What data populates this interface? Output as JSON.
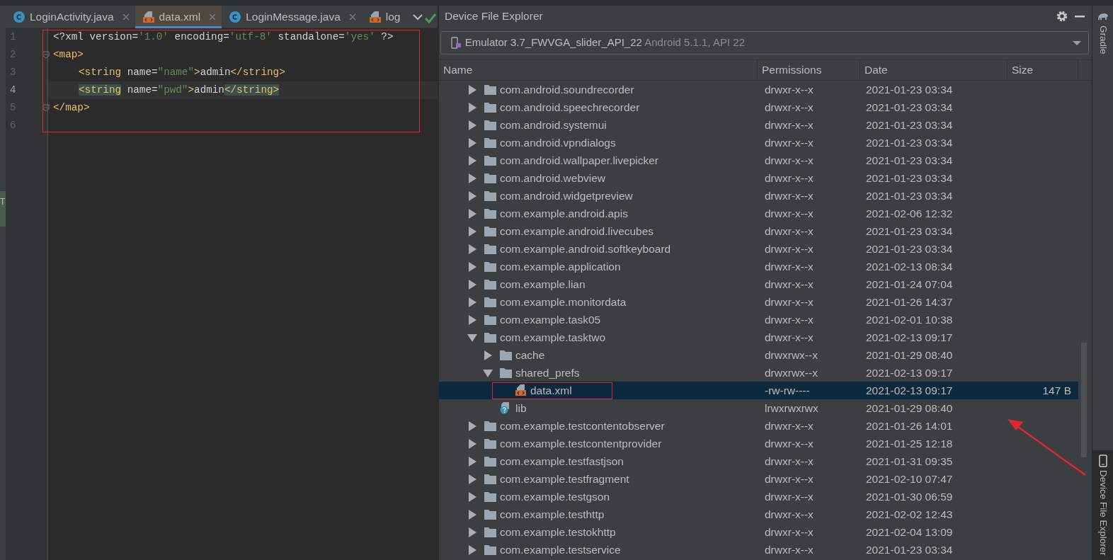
{
  "edge_tab": {
    "label": "T"
  },
  "editor": {
    "tabs": [
      {
        "label": "LoginActivity.java",
        "kind": "class",
        "selected": false
      },
      {
        "label": "data.xml",
        "kind": "xml",
        "selected": true
      },
      {
        "label": "LoginMessage.java",
        "kind": "class",
        "selected": false
      },
      {
        "label": "log",
        "kind": "xml",
        "selected": false
      }
    ],
    "lines": [
      {
        "number": "1",
        "current": false,
        "fold": false,
        "indented": false,
        "tokens": [
          {
            "kind": "plain",
            "text": "<?xml version="
          },
          {
            "kind": "value",
            "text": "'1.0'"
          },
          {
            "kind": "plain",
            "text": " encoding="
          },
          {
            "kind": "value",
            "text": "'utf-8'"
          },
          {
            "kind": "plain",
            "text": " standalone="
          },
          {
            "kind": "value",
            "text": "'yes'"
          },
          {
            "kind": "plain",
            "text": " ?>"
          }
        ]
      },
      {
        "number": "2",
        "current": false,
        "fold": true,
        "indented": false,
        "tokens": [
          {
            "kind": "tag",
            "text": "<map>"
          }
        ]
      },
      {
        "number": "3",
        "current": false,
        "fold": false,
        "indented": true,
        "tokens": [
          {
            "kind": "tag",
            "text": "<string"
          },
          {
            "kind": "plain",
            "text": " name="
          },
          {
            "kind": "value",
            "text": "\"name\""
          },
          {
            "kind": "tag",
            "text": ">"
          },
          {
            "kind": "plain",
            "text": "admin"
          },
          {
            "kind": "tag",
            "text": "</string>"
          }
        ]
      },
      {
        "number": "4",
        "current": true,
        "fold": false,
        "indented": true,
        "tokens": [
          {
            "kind": "match",
            "text": "<string"
          },
          {
            "kind": "plain",
            "text": " name="
          },
          {
            "kind": "value",
            "text": "\"pwd\""
          },
          {
            "kind": "tag",
            "text": ">"
          },
          {
            "kind": "plain",
            "text": "admin"
          },
          {
            "kind": "match",
            "text": "</string>"
          }
        ]
      },
      {
        "number": "5",
        "current": false,
        "fold": true,
        "indented": false,
        "tokens": [
          {
            "kind": "tag",
            "text": "</map>"
          }
        ]
      },
      {
        "number": "6",
        "current": false,
        "fold": false
      }
    ]
  },
  "explorer": {
    "title": "Device File Explorer",
    "device": {
      "name": "Emulator 3.7_FWVGA_slider_API_22",
      "details": "Android 5.1.1, API 22"
    },
    "columns": [
      "Name",
      "Permissions",
      "Date",
      "Size"
    ],
    "rows": [
      {
        "name": "com.android.soundrecorder",
        "kind": "folder",
        "expanded": false,
        "selected": false,
        "permissions": "drwxr-x--x",
        "date": "2021-01-23 03:34"
      },
      {
        "name": "com.android.speechrecorder",
        "kind": "folder",
        "expanded": false,
        "selected": false,
        "permissions": "drwxr-x--x",
        "date": "2021-01-23 03:34"
      },
      {
        "name": "com.android.systemui",
        "kind": "folder",
        "expanded": false,
        "selected": false,
        "permissions": "drwxr-x--x",
        "date": "2021-01-23 03:34"
      },
      {
        "name": "com.android.vpndialogs",
        "kind": "folder",
        "expanded": false,
        "selected": false,
        "permissions": "drwxr-x--x",
        "date": "2021-01-23 03:34"
      },
      {
        "name": "com.android.wallpaper.livepicker",
        "kind": "folder",
        "expanded": false,
        "selected": false,
        "permissions": "drwxr-x--x",
        "date": "2021-01-23 03:34"
      },
      {
        "name": "com.android.webview",
        "kind": "folder",
        "expanded": false,
        "selected": false,
        "permissions": "drwxr-x--x",
        "date": "2021-01-23 03:34"
      },
      {
        "name": "com.android.widgetpreview",
        "kind": "folder",
        "expanded": false,
        "selected": false,
        "permissions": "drwxr-x--x",
        "date": "2021-01-23 03:34"
      },
      {
        "name": "com.example.android.apis",
        "kind": "folder",
        "expanded": false,
        "selected": false,
        "permissions": "drwxr-x--x",
        "date": "2021-02-06 12:32"
      },
      {
        "name": "com.example.android.livecubes",
        "kind": "folder",
        "expanded": false,
        "selected": false,
        "permissions": "drwxr-x--x",
        "date": "2021-01-23 03:34"
      },
      {
        "name": "com.example.android.softkeyboard",
        "kind": "folder",
        "expanded": false,
        "selected": false,
        "permissions": "drwxr-x--x",
        "date": "2021-01-23 03:34"
      },
      {
        "name": "com.example.application",
        "kind": "folder",
        "expanded": false,
        "selected": false,
        "permissions": "drwxr-x--x",
        "date": "2021-02-13 08:34"
      },
      {
        "name": "com.example.lian",
        "kind": "folder",
        "expanded": false,
        "selected": false,
        "permissions": "drwxr-x--x",
        "date": "2021-01-24 07:04"
      },
      {
        "name": "com.example.monitordata",
        "kind": "folder",
        "expanded": false,
        "selected": false,
        "permissions": "drwxr-x--x",
        "date": "2021-01-26 14:37"
      },
      {
        "name": "com.example.task05",
        "kind": "folder",
        "expanded": false,
        "selected": false,
        "permissions": "drwxr-x--x",
        "date": "2021-02-01 10:38"
      },
      {
        "name": "com.example.tasktwo",
        "kind": "folder",
        "expanded": true,
        "selected": false,
        "permissions": "drwxr-x--x",
        "date": "2021-02-13 09:17",
        "children": [
          {
            "name": "cache",
            "kind": "folder",
            "expanded": false,
            "selected": false,
            "permissions": "drwxrwx--x",
            "date": "2021-01-29 08:40"
          },
          {
            "name": "shared_prefs",
            "kind": "folder",
            "expanded": true,
            "selected": false,
            "permissions": "drwxrwx--x",
            "date": "2021-02-13 09:17",
            "children": [
              {
                "name": "data.xml",
                "kind": "xml",
                "selected": true,
                "framed": true,
                "permissions": "-rw-rw----",
                "date": "2021-02-13 09:17",
                "size": "147 B"
              }
            ]
          },
          {
            "name": "lib",
            "kind": "link",
            "selected": false,
            "permissions": "lrwxrwxrwx",
            "date": "2021-01-29 08:40"
          }
        ]
      },
      {
        "name": "com.example.testcontentobserver",
        "kind": "folder",
        "expanded": false,
        "selected": false,
        "permissions": "drwxr-x--x",
        "date": "2021-01-26 14:01"
      },
      {
        "name": "com.example.testcontentprovider",
        "kind": "folder",
        "expanded": false,
        "selected": false,
        "permissions": "drwxr-x--x",
        "date": "2021-01-25 12:18"
      },
      {
        "name": "com.example.testfastjson",
        "kind": "folder",
        "expanded": false,
        "selected": false,
        "permissions": "drwxr-x--x",
        "date": "2021-01-31 09:35"
      },
      {
        "name": "com.example.testfragment",
        "kind": "folder",
        "expanded": false,
        "selected": false,
        "permissions": "drwxr-x--x",
        "date": "2021-02-10 07:47"
      },
      {
        "name": "com.example.testgson",
        "kind": "folder",
        "expanded": false,
        "selected": false,
        "permissions": "drwxr-x--x",
        "date": "2021-01-30 06:59"
      },
      {
        "name": "com.example.testhttp",
        "kind": "folder",
        "expanded": false,
        "selected": false,
        "permissions": "drwxr-x--x",
        "date": "2021-02-02 12:43"
      },
      {
        "name": "com.example.testokhttp",
        "kind": "folder",
        "expanded": false,
        "selected": false,
        "permissions": "drwxr-x--x",
        "date": "2021-02-04 13:09"
      },
      {
        "name": "com.example.testservice",
        "kind": "folder",
        "expanded": false,
        "selected": false,
        "permissions": "drwxr-x--x",
        "date": "2021-01-23 03:34"
      }
    ]
  },
  "side_stripe": [
    {
      "label": "Gradle",
      "kind": "gradle",
      "selected": false
    },
    {
      "label": "Device File Explorer",
      "kind": "device",
      "selected": true
    }
  ]
}
